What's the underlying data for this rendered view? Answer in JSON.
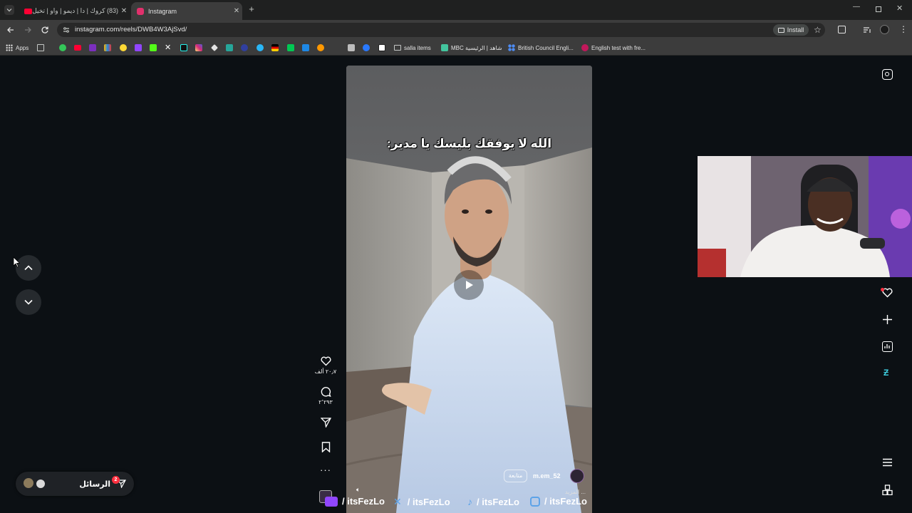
{
  "browser": {
    "tabs": [
      {
        "label": "(83) كروك | دا | ديمو | واو | تخيل",
        "active": false
      },
      {
        "label": "Instagram",
        "active": true
      }
    ],
    "url": "instagram.com/reels/DWB4W3AjSvd/",
    "install_label": "Install",
    "bookmarks": {
      "apps": "Apps",
      "salla": "salla items",
      "mbc": "MBC شاهد | الرئيسية",
      "british": "British Council Engli...",
      "english": "English test with fre..."
    }
  },
  "reel": {
    "caption": "الله لا يوفقك بليسك يا مدير:",
    "likes": "٢٠٫٧ ألف",
    "comments": "٢٬٢٩٣",
    "username": "m.em_52",
    "follow_label": "متابعة",
    "more_label": "... المزيد"
  },
  "messages": {
    "label": "الرسائل",
    "badge": "2"
  },
  "watermark": {
    "items": [
      "/ itsFezLo",
      "/ itsFezLo",
      "/ itsFezLo",
      "/ itsFezLo"
    ]
  },
  "colors": {
    "page_bg": "#0c1014",
    "badge_red": "#ff3040",
    "twitch_purple": "#9146ff"
  }
}
